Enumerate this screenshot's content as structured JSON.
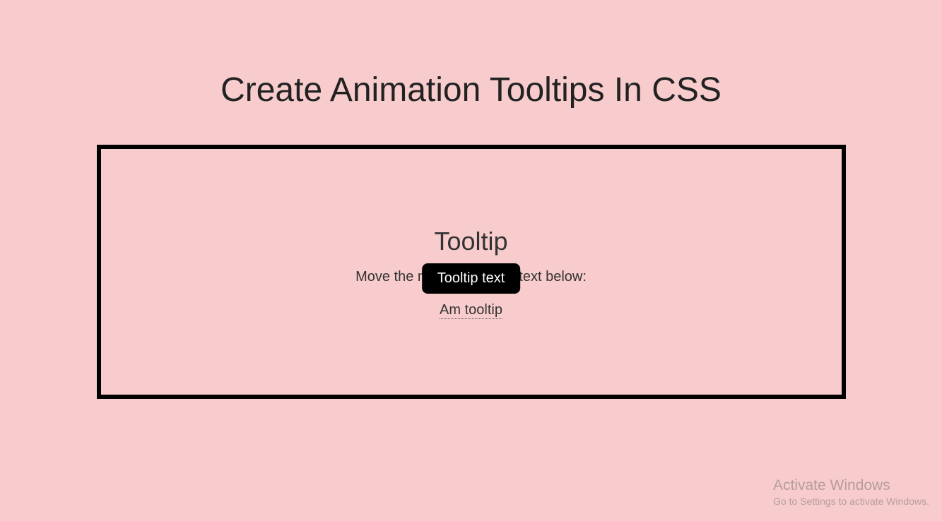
{
  "page": {
    "title": "Create Animation Tooltips In CSS"
  },
  "demo": {
    "heading": "Tooltip",
    "instruction": "Move the mouse over the text below:",
    "tooltip_text": "Tooltip text",
    "trigger_text": "Am tooltip"
  },
  "watermark": {
    "title": "Activate Windows",
    "subtitle": "Go to Settings to activate Windows."
  }
}
